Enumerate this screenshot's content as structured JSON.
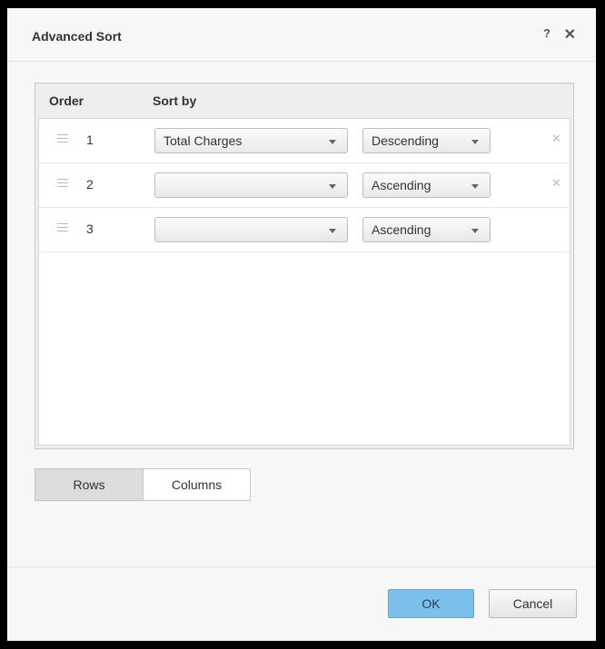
{
  "dialog": {
    "title": "Advanced Sort",
    "help_glyph": "?",
    "close_glyph": "✕"
  },
  "grid": {
    "headers": {
      "order": "Order",
      "sort_by": "Sort by"
    },
    "rows": [
      {
        "order": "1",
        "field": "Total Charges",
        "direction": "Descending",
        "removable": true
      },
      {
        "order": "2",
        "field": "",
        "direction": "Ascending",
        "removable": true
      },
      {
        "order": "3",
        "field": "",
        "direction": "Ascending",
        "removable": false
      }
    ],
    "remove_glyph": "✕"
  },
  "toggle": {
    "rows_label": "Rows",
    "columns_label": "Columns",
    "selected": "Rows"
  },
  "buttons": {
    "ok_label": "OK",
    "cancel_label": "Cancel"
  },
  "colors": {
    "ok_button": "#7ac0ea",
    "toggle_selected": "#dcdcdc"
  }
}
